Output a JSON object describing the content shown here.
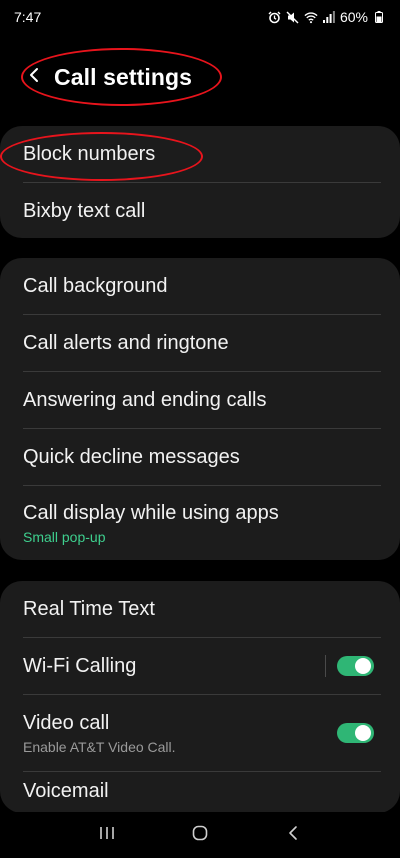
{
  "status_bar": {
    "time": "7:47",
    "battery": "60%",
    "icons": [
      "alarm-icon",
      "mute-icon",
      "wifi-calling-icon",
      "signal-icon",
      "battery-icon"
    ]
  },
  "header": {
    "title": "Call settings",
    "back_icon": "chevron-left-icon"
  },
  "groups": [
    {
      "items": [
        {
          "label": "Block numbers"
        },
        {
          "label": "Bixby text call"
        }
      ]
    },
    {
      "items": [
        {
          "label": "Call background"
        },
        {
          "label": "Call alerts and ringtone"
        },
        {
          "label": "Answering and ending calls"
        },
        {
          "label": "Quick decline messages"
        },
        {
          "label": "Call display while using apps",
          "sub": "Small pop-up"
        }
      ]
    },
    {
      "items": [
        {
          "label": "Real Time Text"
        },
        {
          "label": "Wi-Fi Calling",
          "toggle": true
        },
        {
          "label": "Video call",
          "sub": "Enable AT&T Video Call.",
          "toggle": true
        },
        {
          "label": "Voicemail"
        }
      ]
    }
  ],
  "colors": {
    "accent_green": "#2fb675",
    "annotation_red": "#e8141c",
    "sub_green": "#3ecf8e",
    "sub_gray": "#9a9a9a"
  },
  "navbar": {
    "icons": [
      "recents-icon",
      "home-icon",
      "back-icon"
    ]
  }
}
